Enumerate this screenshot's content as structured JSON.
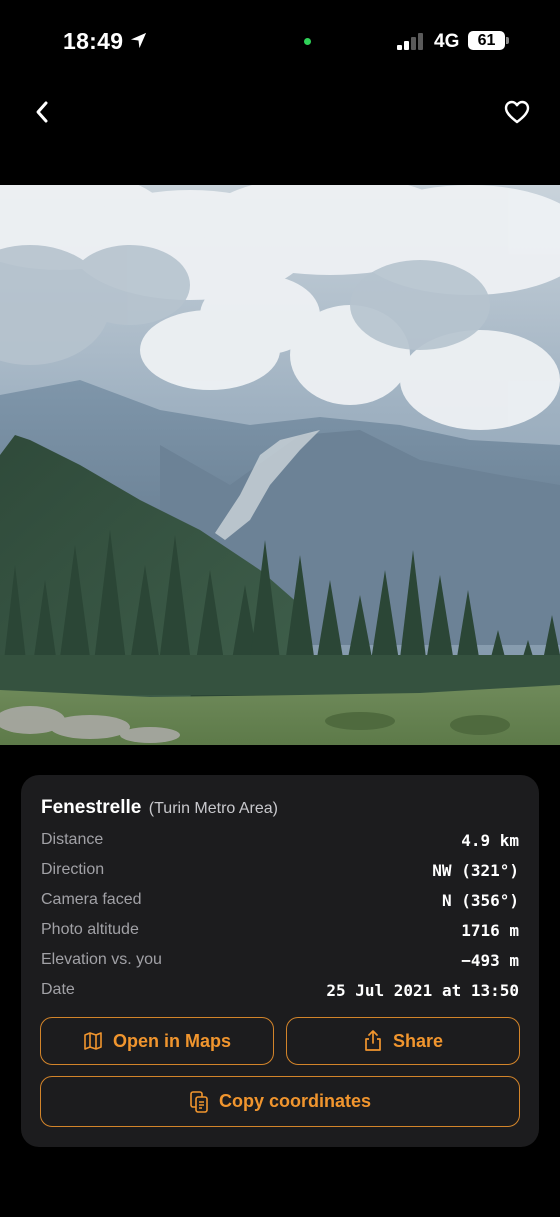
{
  "status_bar": {
    "time": "18:49",
    "network": "4G",
    "battery": "61",
    "signal_bars_filled": 2,
    "signal_bars_total": 4
  },
  "nav": {
    "back_icon": "chevron-left-icon",
    "favorite_icon": "heart-outline-icon"
  },
  "photo": {
    "subject": "mountain-landscape-photo"
  },
  "details": {
    "place": "Fenestrelle",
    "region": "(Turin Metro Area)",
    "rows": [
      {
        "label": "Distance",
        "value": "4.9 km"
      },
      {
        "label": "Direction",
        "value": "NW (321°)"
      },
      {
        "label": "Camera faced",
        "value": "N (356°)"
      },
      {
        "label": "Photo altitude",
        "value": "1716 m"
      },
      {
        "label": "Elevation vs. you",
        "value": "−493 m"
      },
      {
        "label": "Date",
        "value": "25 Jul 2021 at 13:50"
      }
    ]
  },
  "actions": {
    "open_maps": "Open in Maps",
    "share": "Share",
    "copy_coordinates": "Copy coordinates"
  },
  "colors": {
    "accent": "#f0952e",
    "accent_border": "#d2842a",
    "card_bg": "#1c1c1e",
    "label": "#a1a1a6",
    "gps_dot": "#2fd158"
  }
}
